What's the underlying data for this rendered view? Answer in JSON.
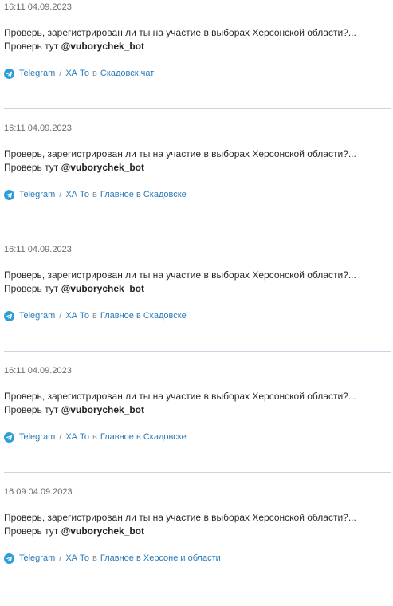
{
  "colors": {
    "link": "#2a7ab8",
    "telegram": "#2a9fd8",
    "divider": "#c9d6e2"
  },
  "posts": [
    {
      "time": "16:11 04.09.2023",
      "text_before": "Проверь, зарегистрирован ли ты на участие в выборах Херсонской области?... Проверь тут ",
      "mention": "@vuborychek_bot",
      "platform": "Telegram",
      "separator": "/",
      "author": "ХА То",
      "in_word": "в",
      "channel": "Скадовск чат",
      "icon": "telegram-icon"
    },
    {
      "time": "16:11 04.09.2023",
      "text_before": "Проверь, зарегистрирован ли ты на участие в выборах Херсонской области?... Проверь тут ",
      "mention": "@vuborychek_bot",
      "platform": "Telegram",
      "separator": "/",
      "author": "ХА То",
      "in_word": "в",
      "channel": "Главное в Скадовске",
      "icon": "telegram-icon"
    },
    {
      "time": "16:11 04.09.2023",
      "text_before": "Проверь, зарегистрирован ли ты на участие в выборах Херсонской области?... Проверь тут ",
      "mention": "@vuborychek_bot",
      "platform": "Telegram",
      "separator": "/",
      "author": "ХА То",
      "in_word": "в",
      "channel": "Главное в Скадовске",
      "icon": "telegram-icon"
    },
    {
      "time": "16:11 04.09.2023",
      "text_before": "Проверь, зарегистрирован ли ты на участие в выборах Херсонской области?... Проверь тут ",
      "mention": "@vuborychek_bot",
      "platform": "Telegram",
      "separator": "/",
      "author": "ХА То",
      "in_word": "в",
      "channel": "Главное в Скадовске",
      "icon": "telegram-icon"
    },
    {
      "time": "16:09 04.09.2023",
      "text_before": "Проверь, зарегистрирован ли ты на участие в выборах Херсонской области?... Проверь тут ",
      "mention": "@vuborychek_bot",
      "platform": "Telegram",
      "separator": "/",
      "author": "ХА То",
      "in_word": "в",
      "channel": "Главное в Херсоне и области",
      "icon": "telegram-icon"
    }
  ]
}
